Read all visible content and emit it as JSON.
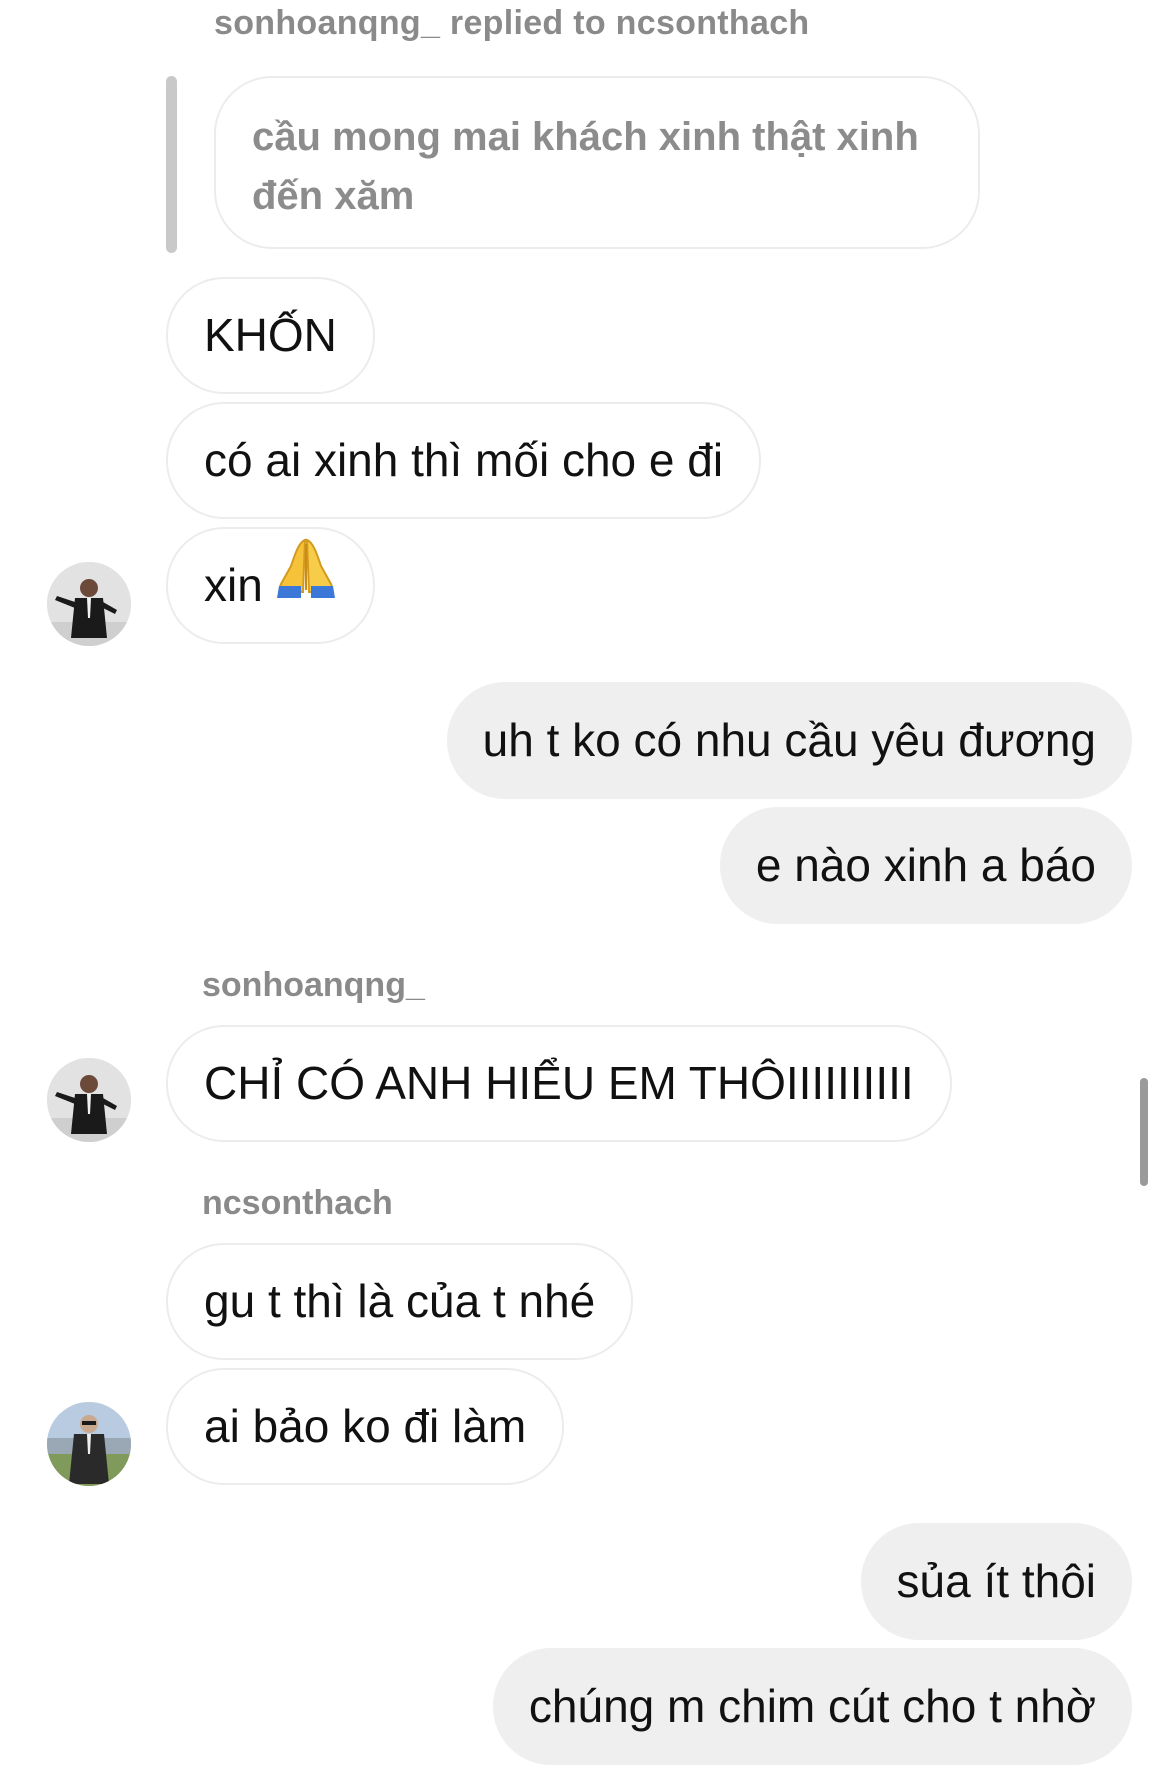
{
  "reply_header": "sonhoanqng_ replied to ncsonthach",
  "quoted_message": "cầu mong mai khách xinh thật xinh đến xăm",
  "messages": [
    {
      "text": "KHỐN"
    },
    {
      "text": "có ai xinh thì mối cho e đi"
    },
    {
      "text": "xin",
      "emoji": "folded-hands"
    },
    {
      "text": "uh t ko có nhu cầu yêu đương"
    },
    {
      "text": "e nào xinh a báo"
    },
    {
      "sender": "sonhoanqng_",
      "text": "CHỈ CÓ ANH HIỂU EM THÔIIIIIIIIII"
    },
    {
      "sender": "ncsonthach",
      "text": "gu t thì là của t nhé"
    },
    {
      "text": "ai bảo ko đi làm"
    },
    {
      "text": "sủa ít thôi"
    },
    {
      "text": "chúng m chim cút cho t nhờ"
    }
  ],
  "colors": {
    "incoming_border": "#ececec",
    "outgoing_bg": "#efefef",
    "meta_text": "#8a8a8a",
    "quote_bar": "#c9c9c9"
  },
  "icons": {
    "avatar_1": "profile-photo-man-suit",
    "avatar_2": "profile-photo-man-sunglasses",
    "emoji": "folded-hands-emoji"
  }
}
